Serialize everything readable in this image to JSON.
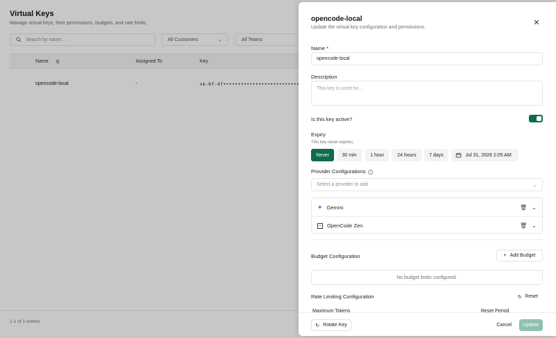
{
  "page": {
    "title": "Virtual Keys",
    "subtitle": "Manage virtual keys, their permissions, budgets, and rate limits.",
    "search_placeholder": "Search by name...",
    "customers_filter": "All Customers",
    "teams_filter": "All Teams",
    "columns": [
      "Name",
      "Assigned To",
      "Key"
    ],
    "row": {
      "name": "opencode-local",
      "assigned_to": "-",
      "key": "sk-bf-4f••••••••••••••••••••••••••••"
    },
    "footer": "1-1 of 1 entries"
  },
  "drawer": {
    "title": "opencode-local",
    "subtitle": "Update the virtual key configuration and permissions.",
    "name_label": "Name *",
    "name_value": "opencode-local",
    "description_label": "Description",
    "description_placeholder": "This key is used for...",
    "active_label": "Is this key active?",
    "active": true,
    "expiry_label": "Expiry",
    "expiry_hint": "This key never expires.",
    "expiry_options": [
      "Never",
      "30 min",
      "1 hour",
      "24 hours",
      "7 days"
    ],
    "expiry_selected": "Never",
    "expiry_date": "Jul 31, 2026 2:05 AM",
    "provider_label": "Provider Configurations",
    "provider_placeholder": "Select a provider to add",
    "providers": [
      "Gemini",
      "OpenCode Zen"
    ],
    "budget_label": "Budget Configuration",
    "add_budget": "Add Budget",
    "budget_empty": "No budget limits configured.",
    "rate_label": "Rate Limiting Configuration",
    "reset": "Reset",
    "cut_left": "Maximum Tokens",
    "cut_right": "Reset Period",
    "rotate": "Rotate Key",
    "cancel": "Cancel",
    "update": "Update"
  },
  "colors": {
    "accent": "#0f6b4f",
    "update_disabled": "#8fc2ae"
  }
}
